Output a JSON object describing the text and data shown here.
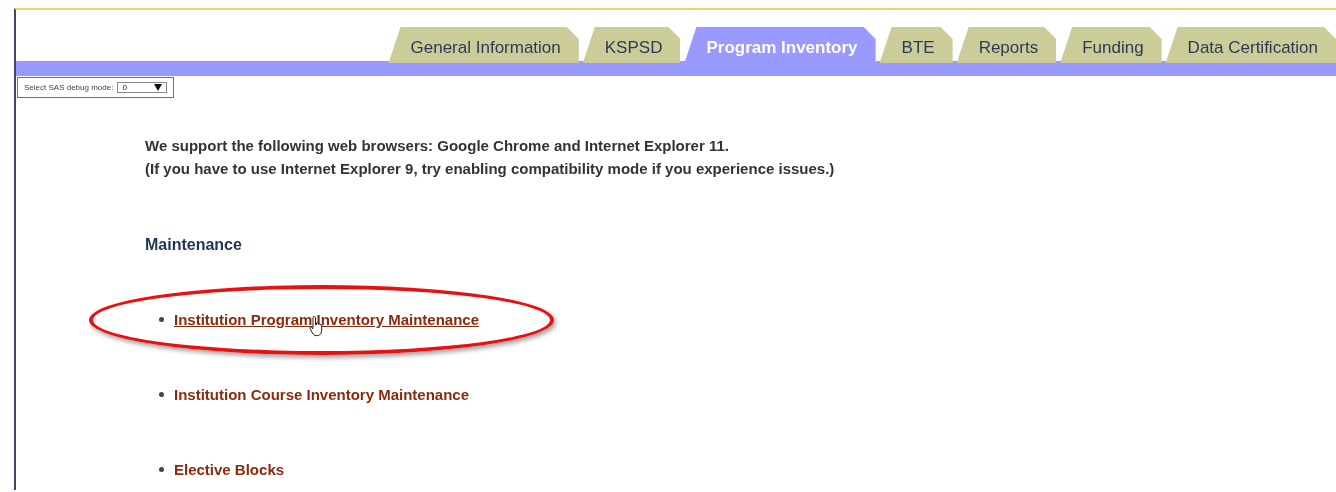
{
  "tabs": [
    {
      "label": "General Information",
      "selected": false
    },
    {
      "label": "KSPSD",
      "selected": false
    },
    {
      "label": "Program Inventory",
      "selected": true
    },
    {
      "label": "BTE",
      "selected": false
    },
    {
      "label": "Reports",
      "selected": false
    },
    {
      "label": "Funding",
      "selected": false
    },
    {
      "label": "Data Certification",
      "selected": false
    }
  ],
  "debug": {
    "label": "Select SAS debug mode:",
    "value": "0"
  },
  "notice": [
    "We support the following web browsers: Google Chrome and Internet Explorer 11.",
    "(If you have to use Internet Explorer 9, try enabling compatibility mode if you experience issues.)"
  ],
  "section": {
    "title": "Maintenance",
    "links": [
      {
        "label": "Institution Program Inventory Maintenance",
        "hovered": true,
        "circled": true
      },
      {
        "label": "Institution Course Inventory Maintenance",
        "hovered": false,
        "circled": false
      },
      {
        "label": "Elective Blocks",
        "hovered": false,
        "circled": false
      }
    ]
  }
}
